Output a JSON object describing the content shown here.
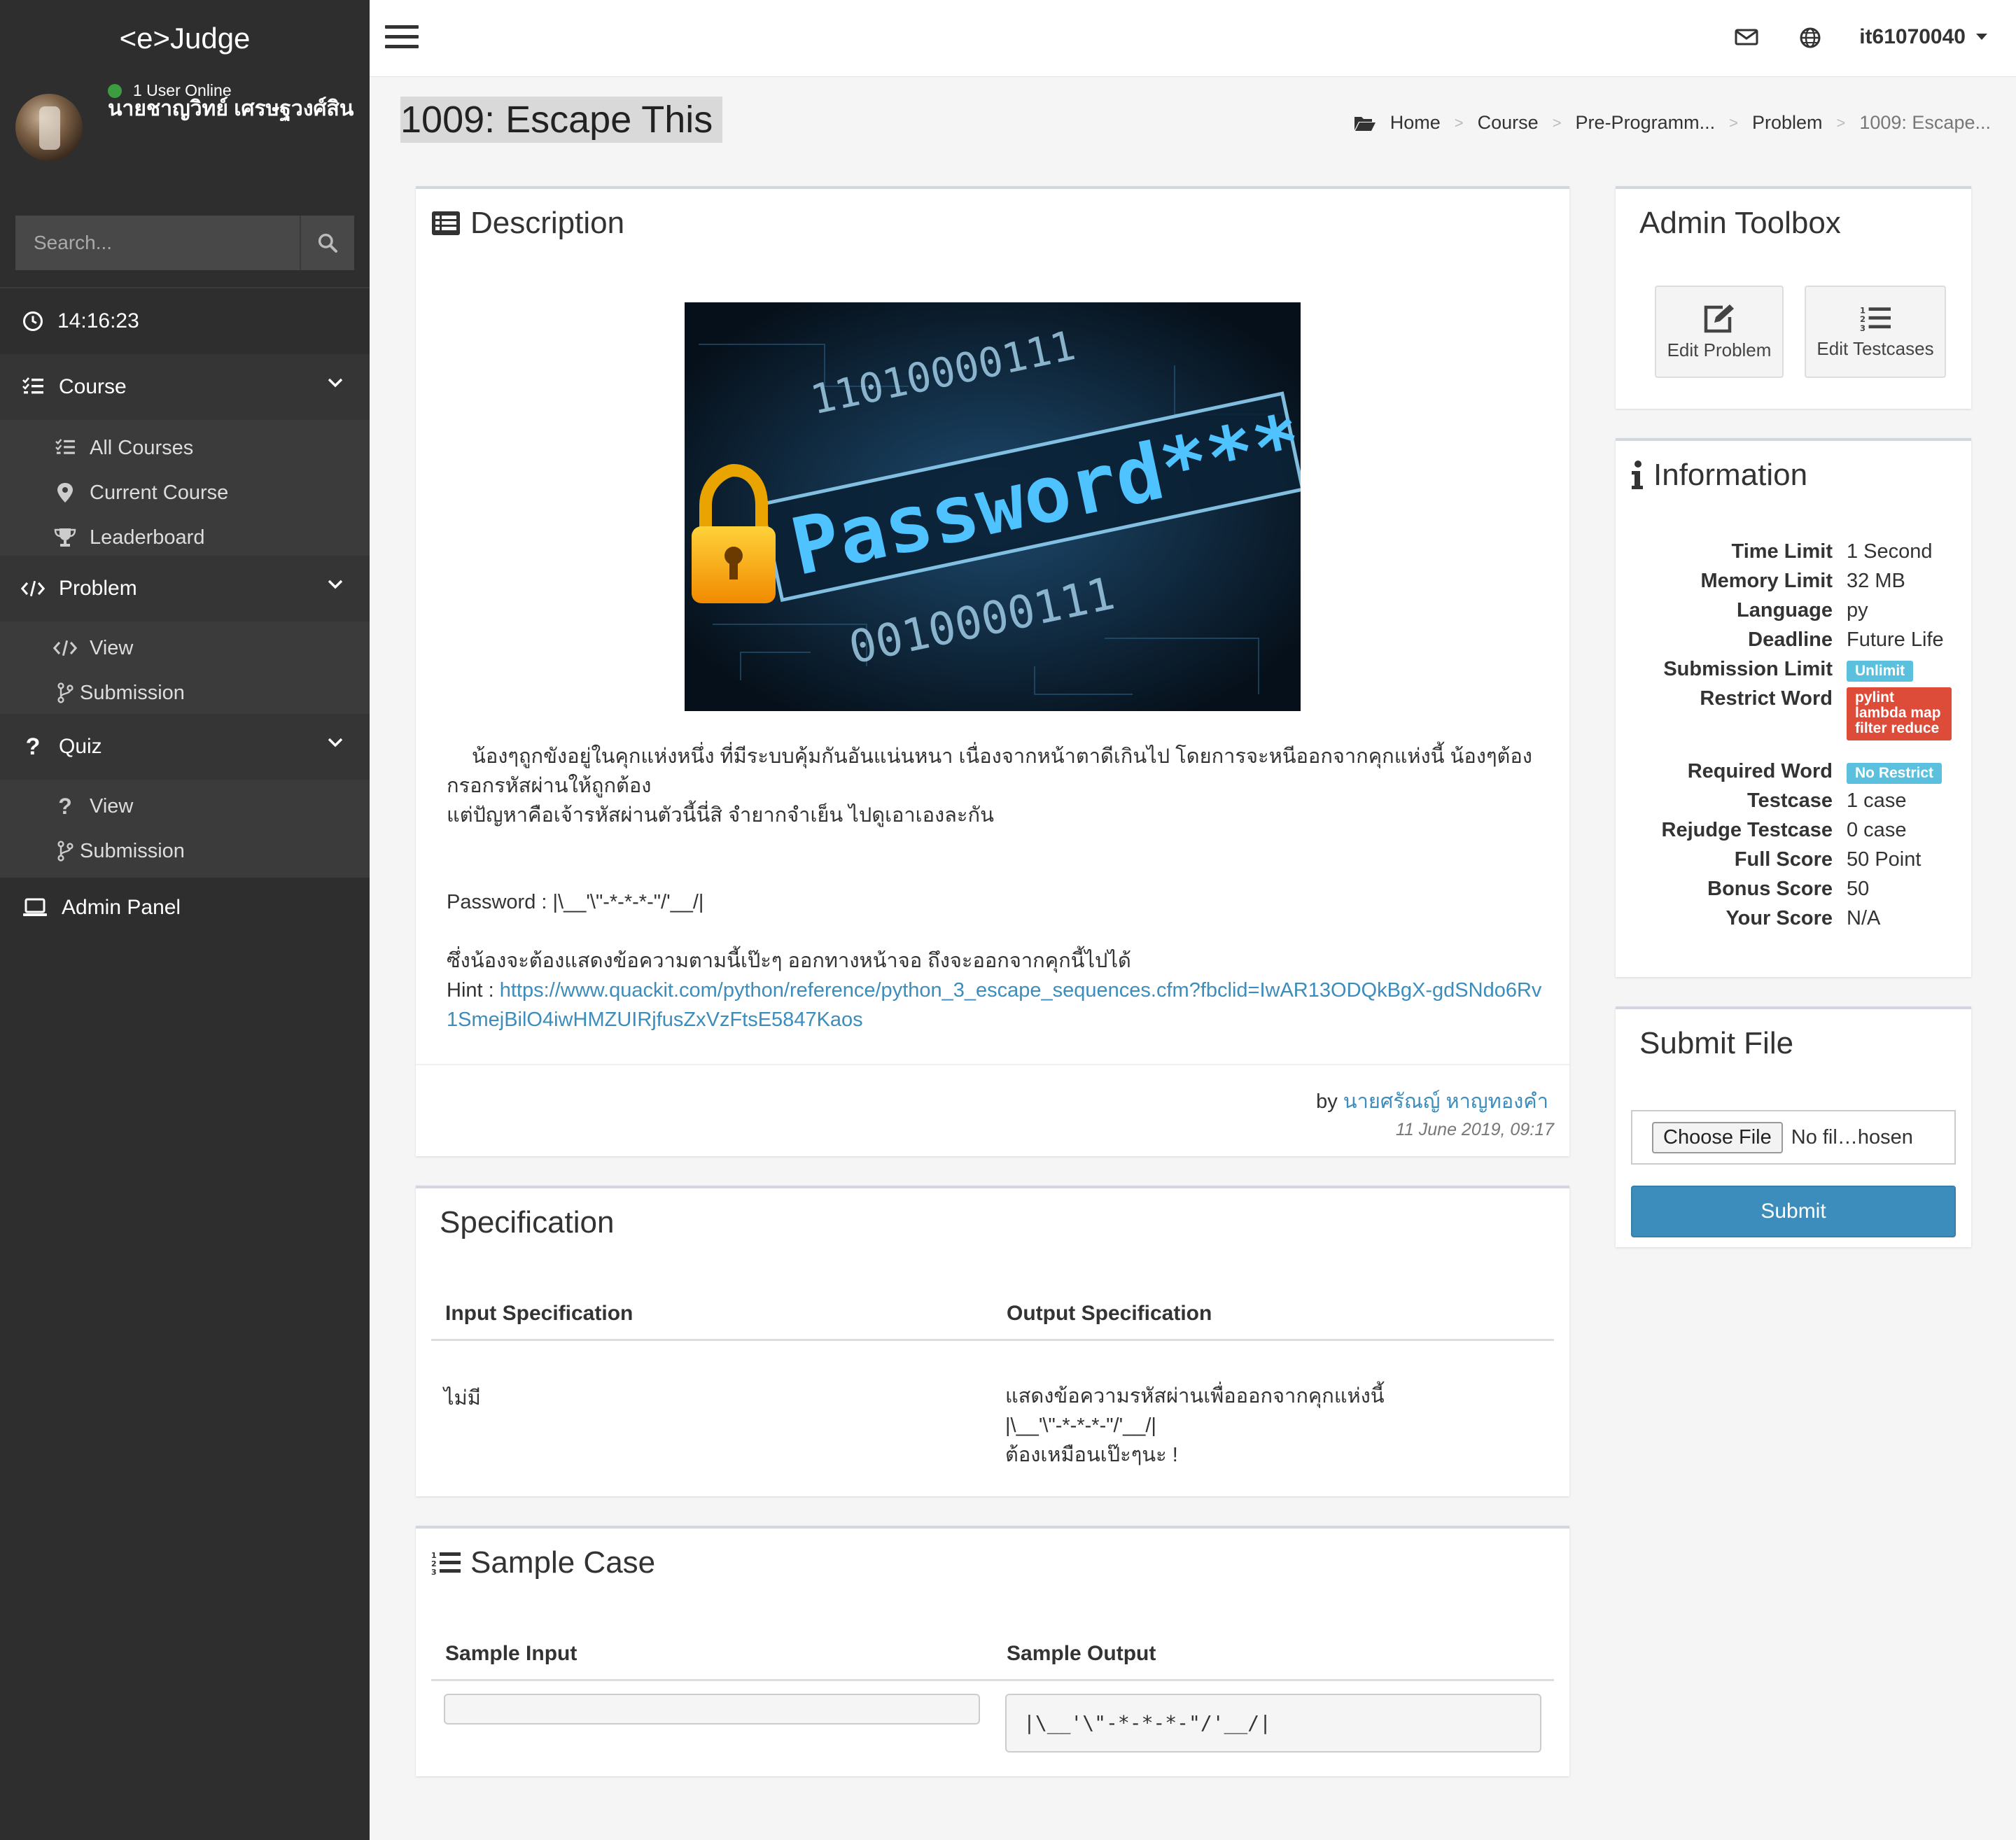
{
  "app": {
    "logo": "<e>Judge"
  },
  "user": {
    "name": "นายชาญวิทย์ เศรษฐวงศ์สิน",
    "online_text": "1 User Online"
  },
  "search": {
    "placeholder": "Search..."
  },
  "clock": "14:16:23",
  "sidebar": {
    "course": {
      "label": "Course",
      "items": [
        {
          "label": "All Courses"
        },
        {
          "label": "Current Course"
        },
        {
          "label": "Leaderboard"
        }
      ]
    },
    "problem": {
      "label": "Problem",
      "items": [
        {
          "label": "View"
        },
        {
          "label": "Submission"
        }
      ]
    },
    "quiz": {
      "label": "Quiz",
      "items": [
        {
          "label": "View"
        },
        {
          "label": "Submission"
        }
      ]
    },
    "admin_panel": "Admin Panel"
  },
  "topbar": {
    "username": "it61070040"
  },
  "page": {
    "title": "1009: Escape This",
    "breadcrumb": [
      "Home",
      "Course",
      "Pre-Programm...",
      "Problem",
      "1009: Escape..."
    ]
  },
  "description": {
    "title": "Description",
    "image_text": {
      "binary_top": "11010000111",
      "word": "Password***",
      "binary_bottom": "0010000111"
    },
    "para1": "น้องๆถูกขังอยู่ในคุกแห่งหนึ่ง ที่มีระบบคุ้มกันอันแน่นหนา เนื่องจากหน้าตาดีเกินไป โดยการจะหนีออกจากคุกแห่งนี้ น้องๆต้องกรอกรหัสผ่านให้ถูกต้อง",
    "para2": "แต่ปัญหาคือเจ้ารหัสผ่านตัวนี้นี่สิ จำยากจำเย็น ไปดูเอาเองละกัน",
    "password": "Password : |\\__'\\\"-*-*-*-\"/'__/|",
    "para3": "ซึ่งน้องจะต้องแสดงข้อความตามนี้เป๊ะๆ ออกทางหน้าจอ ถึงจะออกจากคุกนี้ไปได้",
    "hint_label": "Hint : ",
    "hint_url": "https://www.quackit.com/python/reference/python_3_escape_sequences.cfm?fbclid=IwAR13ODQkBgX-gdSNdo6Rv1SmejBilO4iwHMZUIRjfusZxVzFtsE5847Kaos",
    "by_label": "by ",
    "author": "นายศรัณญ์ หาญทองคำ",
    "date": "11 June 2019, 09:17"
  },
  "specification": {
    "title": "Specification",
    "input_header": "Input Specification",
    "output_header": "Output Specification",
    "input": "ไม่มี",
    "output_lines": [
      "แสดงข้อความรหัสผ่านเพื่อออกจากคุกแห่งนี้",
      "|\\__'\\\"-*-*-*-\"/'__/|",
      "ต้องเหมือนเป๊ะๆนะ !"
    ]
  },
  "sample": {
    "title": "Sample Case",
    "input_header": "Sample Input",
    "output_header": "Sample Output",
    "input": "",
    "output": "|\\__'\\\"-*-*-*-\"/'__/|"
  },
  "toolbox": {
    "title": "Admin Toolbox",
    "edit_problem": "Edit Problem",
    "edit_testcases": "Edit Testcases"
  },
  "information": {
    "title": "Information",
    "rows": [
      {
        "key": "Time Limit",
        "value": "1 Second"
      },
      {
        "key": "Memory Limit",
        "value": "32 MB"
      },
      {
        "key": "Language",
        "value": "py"
      },
      {
        "key": "Deadline",
        "value": "Future Life"
      },
      {
        "key": "Submission Limit",
        "value": "Unlimit"
      },
      {
        "key": "Restrict Word",
        "value": "pylint lambda map filter reduce"
      },
      {
        "key": "Required Word",
        "value": "No Restrict"
      },
      {
        "key": "Testcase",
        "value": "1 case"
      },
      {
        "key": "Rejudge Testcase",
        "value": "0 case"
      },
      {
        "key": "Full Score",
        "value": "50 Point"
      },
      {
        "key": "Bonus Score",
        "value": "50"
      },
      {
        "key": "Your Score",
        "value": "N/A"
      }
    ]
  },
  "submit_file": {
    "title": "Submit File",
    "choose_label": "Choose File",
    "file_status": "No fil…hosen",
    "submit_label": "Submit"
  },
  "colors": {
    "sidebar_bg": "#2e2e2e",
    "accent": "#3c8dbc",
    "badge_info": "#5bc0de",
    "badge_danger": "#dd4b39"
  }
}
